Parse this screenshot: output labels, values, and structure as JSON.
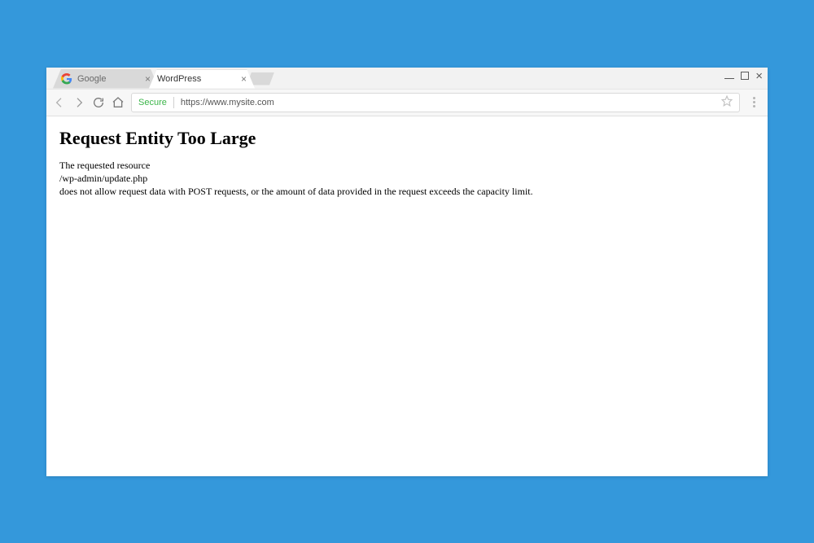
{
  "tabs": [
    {
      "title": "Google",
      "active": false
    },
    {
      "title": "WordPress",
      "active": true
    }
  ],
  "addressbar": {
    "secure_label": "Secure",
    "url": "https://www.mysite.com"
  },
  "page": {
    "heading": "Request Entity Too Large",
    "body_line1": "The requested resource",
    "body_line2": "/wp-admin/update.php",
    "body_line3": "does not allow request data with POST requests, or the amount of data provided in the request exceeds the capacity limit."
  }
}
